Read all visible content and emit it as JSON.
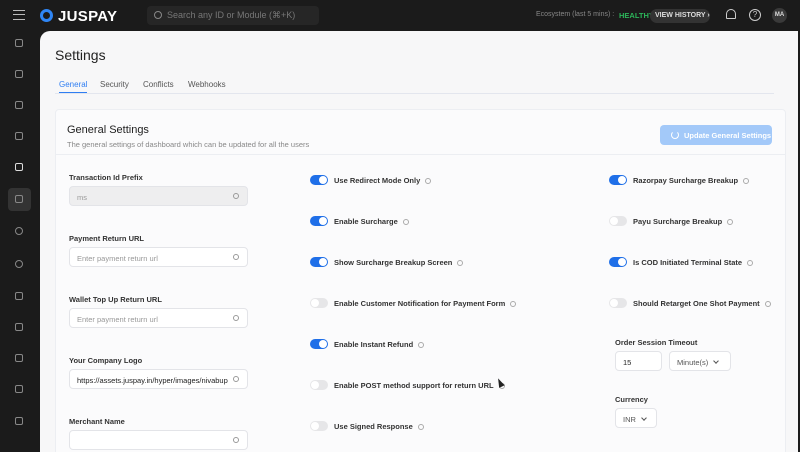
{
  "header": {
    "brand": "JUSPAY",
    "search_placeholder": "Search any ID or Module (⌘+K)",
    "ecosystem_label": "Ecosystem (last 5 mins) :",
    "ecosystem_status": "HEALTHY",
    "view_history": "VIEW HISTORY ›",
    "avatar": "MA",
    "status_color": "#2cb55a"
  },
  "page": {
    "title": "Settings",
    "tabs": [
      "General",
      "Security",
      "Conflicts",
      "Webhooks"
    ]
  },
  "card": {
    "title": "General Settings",
    "subtitle": "The general settings of dashboard which can be updated for all the users",
    "update_button": "Update General Settings"
  },
  "fields": [
    {
      "label": "Transaction Id Prefix",
      "value": "ms",
      "placeholder": ""
    },
    {
      "label": "Payment Return URL",
      "value": "",
      "placeholder": "Enter payment return url"
    },
    {
      "label": "Wallet Top Up Return URL",
      "value": "",
      "placeholder": "Enter payment return url"
    },
    {
      "label": "Your Company Logo",
      "value": "https://assets.juspay.in/hyper/images/nivabup",
      "placeholder": ""
    },
    {
      "label": "Merchant Name",
      "value": "",
      "placeholder": ""
    }
  ],
  "toggles_mid": [
    {
      "label": "Use Redirect Mode Only",
      "on": true
    },
    {
      "label": "Enable Surcharge",
      "on": true
    },
    {
      "label": "Show Surcharge Breakup Screen",
      "on": true
    },
    {
      "label": "Enable Customer Notification for Payment Form",
      "on": false
    },
    {
      "label": "Enable Instant Refund",
      "on": true
    },
    {
      "label": "Enable POST method support for return URL",
      "on": false
    },
    {
      "label": "Use Signed Response",
      "on": false
    }
  ],
  "toggles_right": [
    {
      "label": "Razorpay Surcharge Breakup",
      "on": true
    },
    {
      "label": "Payu Surcharge Breakup",
      "on": false
    },
    {
      "label": "Is COD Initiated Terminal State",
      "on": true
    },
    {
      "label": "Should Retarget One Shot Payment",
      "on": false
    }
  ],
  "order_session": {
    "label": "Order Session Timeout",
    "value": "15",
    "unit": "Minute(s)"
  },
  "currency": {
    "label": "Currency",
    "value": "INR"
  }
}
